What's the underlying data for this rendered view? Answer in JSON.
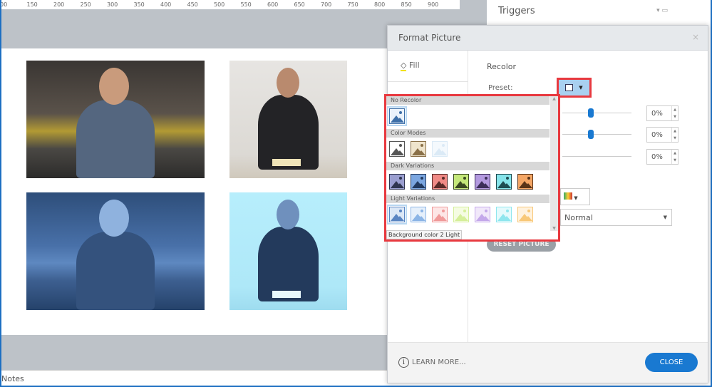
{
  "ruler": {
    "ticks": [
      "00",
      "150",
      "200",
      "250",
      "300",
      "350",
      "400",
      "450",
      "500",
      "550",
      "600",
      "650",
      "700",
      "750",
      "800",
      "850",
      "900"
    ]
  },
  "right_pane": {
    "title": "Triggers"
  },
  "notes": {
    "label": "Notes"
  },
  "dialog": {
    "title": "Format Picture",
    "close_x": "×",
    "left_tabs": [
      {
        "label": "Fill"
      }
    ],
    "section_title": "Recolor",
    "preset_label": "Preset:",
    "spinners": [
      "0%",
      "0%",
      "0%"
    ],
    "blend_mode": "Normal",
    "reset_label": "RESET PICTURE",
    "learn_more": "LEARN MORE...",
    "close_label": "CLOSE",
    "gallery": {
      "sections": [
        {
          "title": "No Recolor",
          "swatches": [
            {
              "bg": "#eaf2fb",
              "fg": "#3d6fa8"
            }
          ]
        },
        {
          "title": "Color Modes",
          "swatches": [
            {
              "bg": "#ffffff",
              "fg": "#555555"
            },
            {
              "bg": "#efe4cc",
              "fg": "#8a7048"
            },
            {
              "bg": "#f4f9fd",
              "fg": "#dbeaf6"
            }
          ]
        },
        {
          "title": "Dark Variations",
          "swatches": [
            {
              "bg": "#9a9ed0",
              "fg": "#2f3550"
            },
            {
              "bg": "#7ba6e0",
              "fg": "#223a60"
            },
            {
              "bg": "#f08a86",
              "fg": "#5a2a28"
            },
            {
              "bg": "#c5e87a",
              "fg": "#3b4a22"
            },
            {
              "bg": "#b49ae0",
              "fg": "#3d2f5a"
            },
            {
              "bg": "#86e4ea",
              "fg": "#1f4d52"
            },
            {
              "bg": "#f5a766",
              "fg": "#5a3418"
            }
          ]
        },
        {
          "title": "Light Variations",
          "swatches": [
            {
              "bg": "#dce8f6",
              "fg": "#5b86c2"
            },
            {
              "bg": "#e6f0fb",
              "fg": "#8cb5e6"
            },
            {
              "bg": "#fde6e6",
              "fg": "#f09a9a"
            },
            {
              "bg": "#f5fce2",
              "fg": "#d5ef9a"
            },
            {
              "bg": "#f1e8fa",
              "fg": "#c4a8ea"
            },
            {
              "bg": "#e4fafc",
              "fg": "#8fe6ee"
            },
            {
              "bg": "#fff2de",
              "fg": "#f8c878"
            }
          ]
        }
      ],
      "tooltip": "Background color 2 Light"
    }
  }
}
